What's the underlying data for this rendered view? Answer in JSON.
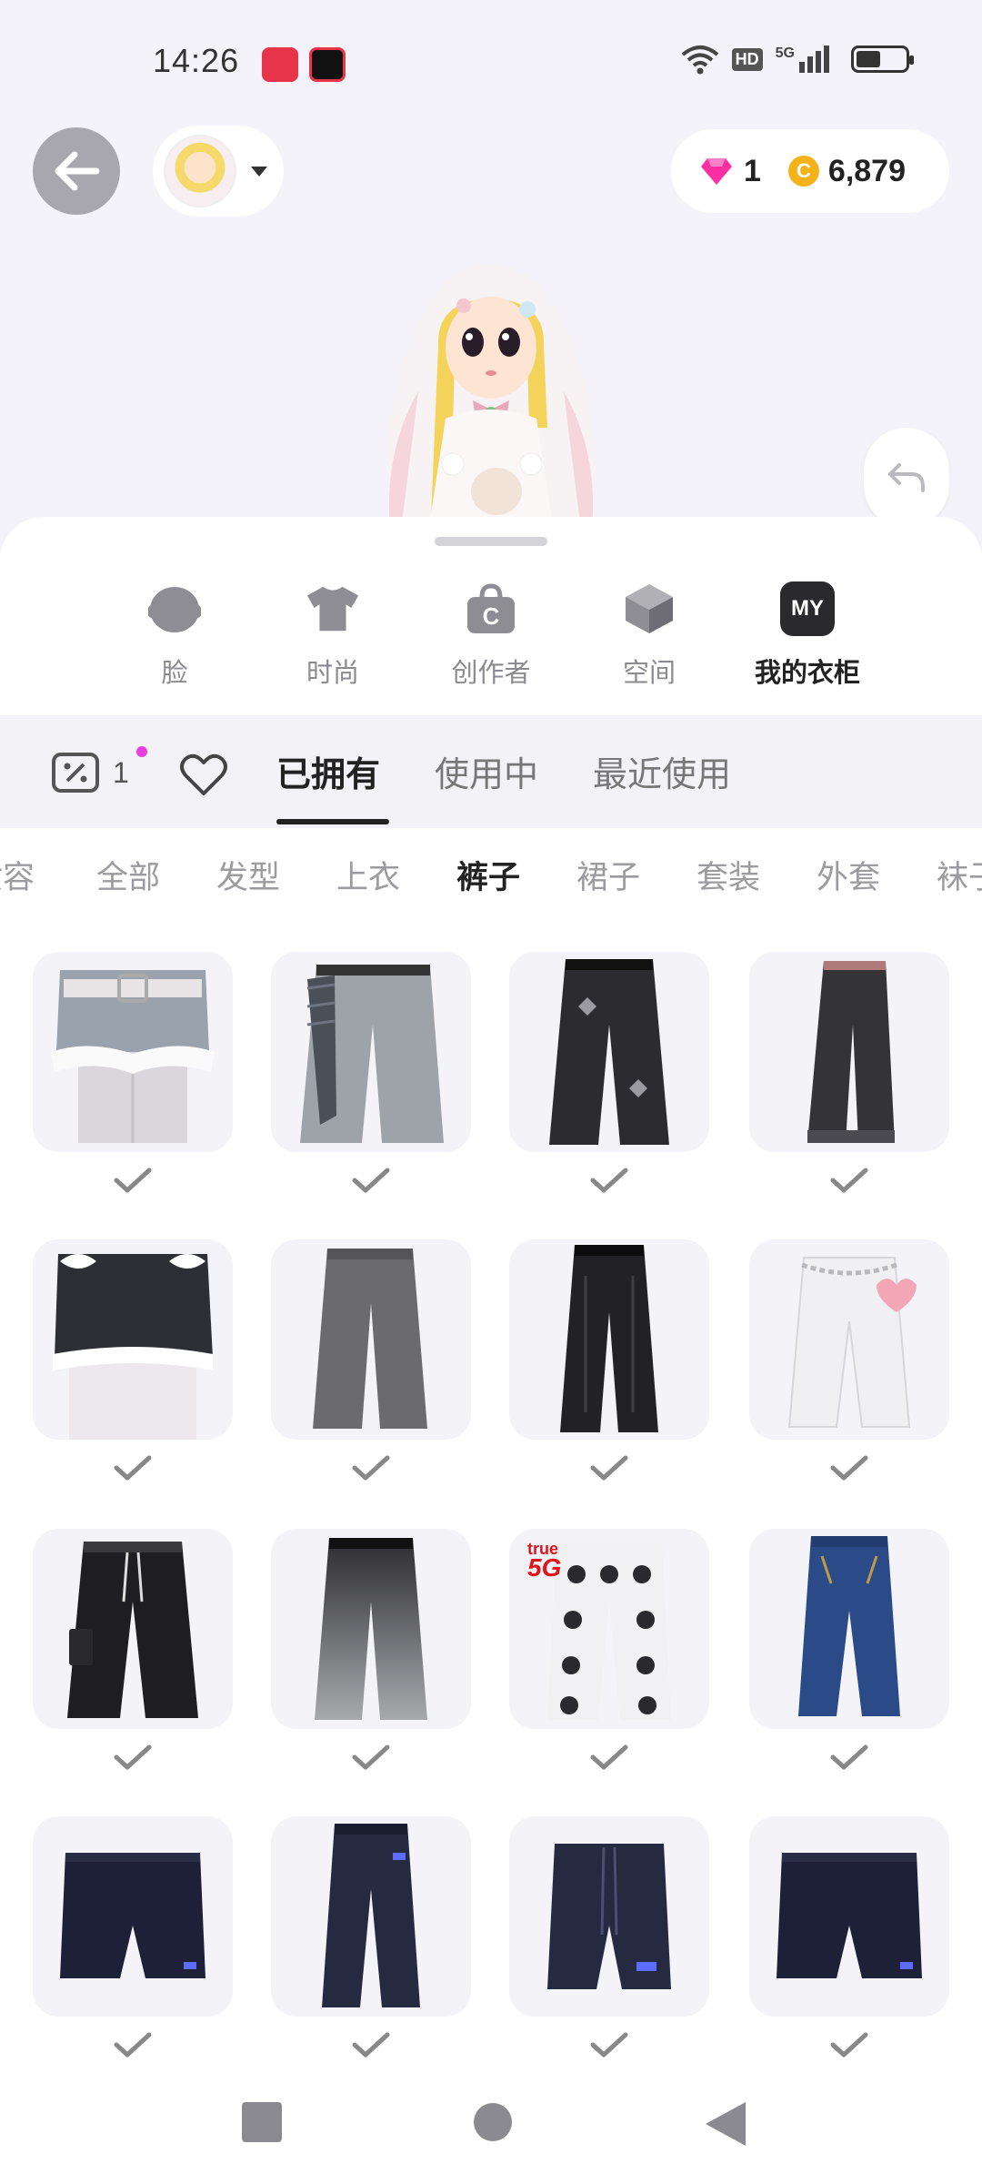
{
  "status_bar": {
    "time": "14:26",
    "hd": "HD",
    "network": "5G",
    "battery_level": 0.45
  },
  "header": {
    "back_icon": "arrow-left-icon",
    "currency": {
      "gems": "1",
      "coins": "6,879",
      "coin_symbol": "C",
      "gem_color": "#ff2fa3",
      "coin_color": "#f5b319"
    }
  },
  "categories": [
    {
      "label": "脸",
      "icon": "face-icon"
    },
    {
      "label": "时尚",
      "icon": "tshirt-icon"
    },
    {
      "label": "创作者",
      "icon": "creator-bag-icon"
    },
    {
      "label": "空间",
      "icon": "cube-icon"
    },
    {
      "label": "我的衣柜",
      "icon": "my-wardrobe-icon",
      "badge": "MY",
      "active": true
    }
  ],
  "filter_bar": {
    "coupon_count": "1",
    "tabs": [
      "已拥有",
      "使用中",
      "最近使用"
    ],
    "active_tab": "已拥有"
  },
  "subcategories": [
    "妆容",
    "全部",
    "发型",
    "上衣",
    "裤子",
    "裙子",
    "套装",
    "外套",
    "袜子"
  ],
  "active_subcategory": "裤子",
  "items": [
    {
      "name": "grey-denim-fur-shorts",
      "owned": true
    },
    {
      "name": "grey-wide-jeans-plaid",
      "owned": true
    },
    {
      "name": "black-cross-wide-jeans",
      "owned": true
    },
    {
      "name": "black-flare-jeans",
      "owned": true
    },
    {
      "name": "black-lace-bow-shorts",
      "owned": true
    },
    {
      "name": "grey-wide-trousers",
      "owned": true
    },
    {
      "name": "black-baggy-jeans",
      "owned": true
    },
    {
      "name": "white-chain-jeans-heart",
      "owned": true
    },
    {
      "name": "black-cargo-pants",
      "owned": true
    },
    {
      "name": "black-gradient-jeans",
      "owned": true
    },
    {
      "name": "panda-print-pajama-pants",
      "owned": true,
      "badge_top": "true",
      "badge_bottom": "5G"
    },
    {
      "name": "blue-bootcut-jeans",
      "owned": true
    },
    {
      "name": "navy-shorts",
      "owned": true
    },
    {
      "name": "navy-trousers",
      "owned": true
    },
    {
      "name": "navy-drawstring-shorts",
      "owned": true
    },
    {
      "name": "navy-shorts-2",
      "owned": true
    }
  ]
}
